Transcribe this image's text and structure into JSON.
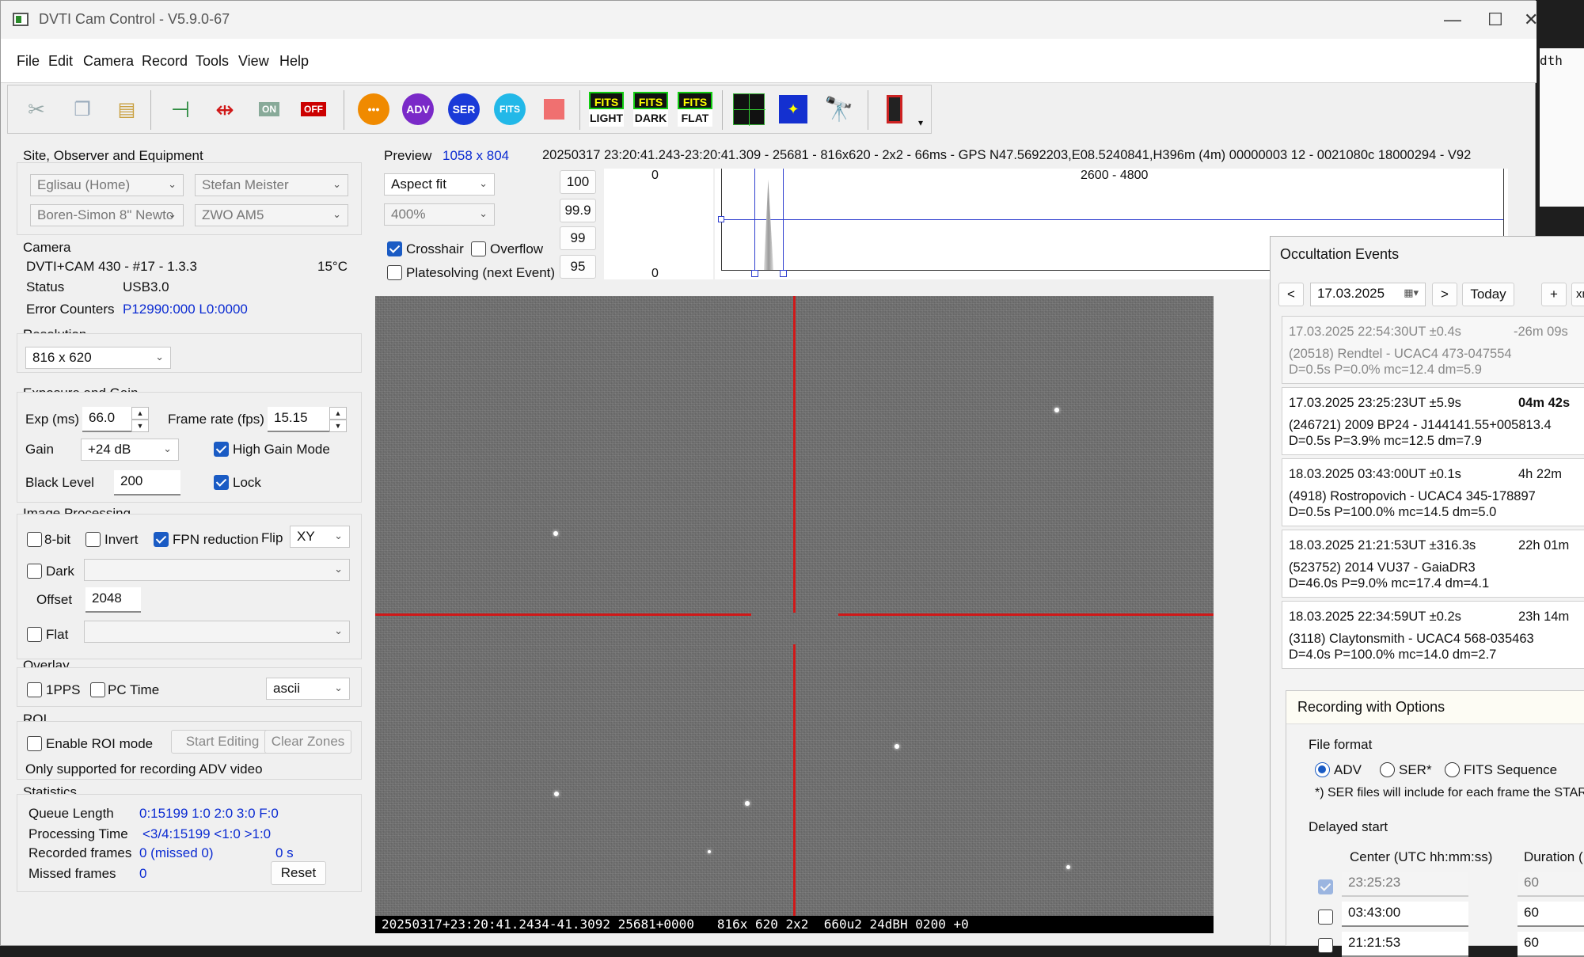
{
  "window": {
    "title": "DVTI Cam Control - V5.9.0-67",
    "min": "—",
    "max": "☐",
    "close": "✕"
  },
  "menu": [
    "File",
    "Edit",
    "Camera",
    "Record",
    "Tools",
    "View",
    "Help"
  ],
  "toolbar": {
    "adv": "ADV",
    "ser": "SER",
    "fits": "FITS",
    "on": "ON",
    "off": "OFF",
    "fits_light": [
      "FITS",
      "LIGHT"
    ],
    "fits_dark": [
      "FITS",
      "DARK"
    ],
    "fits_flat": [
      "FITS",
      "FLAT"
    ],
    "dropdown": "▾"
  },
  "site": {
    "title": "Site, Observer and Equipment",
    "site": "Eglisau (Home)",
    "observer": "Stefan Meister",
    "telescope": "Boren-Simon 8\" Newto",
    "mount": "ZWO AM5"
  },
  "camera": {
    "title": "Camera",
    "model": "DVTI+CAM 430  -  #17  -  1.3.3",
    "temp": "15°C",
    "status_label": "Status",
    "status": "USB3.0",
    "err_label": "Error Counters",
    "errors": "P12990:000 L0:0000"
  },
  "resolution": {
    "title": "Resolution",
    "value": "816 x 620"
  },
  "exposure": {
    "title": "Exposure and Gain",
    "exp_label": "Exp (ms)",
    "exp": "66.0",
    "fr_label": "Frame rate (fps)",
    "fr": "15.15",
    "gain_label": "Gain",
    "gain": "+24 dB",
    "hgm": "High Gain Mode",
    "bl_label": "Black Level",
    "bl": "200",
    "lock": "Lock"
  },
  "processing": {
    "title": "Image Processing",
    "bit8": "8-bit",
    "invert": "Invert",
    "fpn": "FPN reduction",
    "flip_label": "Flip",
    "flip": "XY",
    "dark": "Dark",
    "offset_label": "Offset",
    "offset": "2048",
    "flat": "Flat"
  },
  "overlay": {
    "title": "Overlay",
    "pps": "1PPS",
    "pctime": "PC Time",
    "mode": "ascii"
  },
  "roi": {
    "title": "ROI",
    "enable": "Enable ROI mode",
    "start": "Start Editing",
    "clear": "Clear Zones",
    "note": "Only supported for recording ADV video"
  },
  "stats": {
    "title": "Statistics",
    "ql_label": "Queue Length",
    "ql": "0:15199  1:0  2:0  3:0  F:0",
    "pt_label": "Processing Time",
    "pt": "<3/4:15199 <1:0  >1:0",
    "rf_label": "Recorded frames",
    "rf": "0 (missed 0)",
    "rf_time": "0 s",
    "mf_label": "Missed frames",
    "mf": "0",
    "reset": "Reset"
  },
  "preview": {
    "label": "Preview",
    "size": "1058 x 804",
    "info": "20250317 23:20:41.243-23:20:41.309 - 25681 - 816x620 - 2x2 - 66ms - GPS N47.5692203,E08.5240841,H396m (4m) 00000003 12 - 0021080c 18000294 - V92",
    "fit": "Aspect fit",
    "zoom": "400%",
    "crosshair": "Crosshair",
    "overflow": "Overflow",
    "platesolve": "Platesolving (next Event)",
    "levels": [
      "100",
      "99.9",
      "99",
      "95"
    ],
    "hist_top": "0",
    "hist_bottom": "0",
    "hist_range": "2600 - 4800"
  },
  "osd": "20250317+23:20:41.2434-41.3092 25681+0000   816x 620 2x2  660u2 24dBH 0200 +0",
  "occultation": {
    "title": "Occultation Events",
    "prev": "<",
    "date": "17.03.2025",
    "next": ">",
    "today": "Today",
    "plus": "+",
    "xm": "xm",
    "events": [
      {
        "time": "17.03.2025 22:54:30UT ±0.4s",
        "rel": "-26m 09s",
        "obj": "(20518) Rendtel - UCAC4 473-047554",
        "params": "D=0.5s   P=0.0%   mc=12.4   dm=5.9"
      },
      {
        "time": "17.03.2025 23:25:23UT  ±5.9s",
        "rel": "04m 42s",
        "obj": "(246721) 2009 BP24 - J144141.55+005813.4",
        "params": "D=0.5s   P=3.9%   mc=12.5   dm=7.9"
      },
      {
        "time": "18.03.2025 03:43:00UT ±0.1s",
        "rel": "4h 22m",
        "obj": "(4918) Rostropovich - UCAC4 345-178897",
        "params": "D=0.5s   P=100.0%   mc=14.5   dm=5.0"
      },
      {
        "time": "18.03.2025 21:21:53UT  ±316.3s",
        "rel": "22h 01m",
        "obj": "(523752) 2014 VU37 - GaiaDR3",
        "params": "D=46.0s   P=9.0%   mc=17.4   dm=4.1"
      },
      {
        "time": "18.03.2025 22:34:59UT ±0.2s",
        "rel": "23h 14m",
        "obj": "(3118) Claytonsmith - UCAC4 568-035463",
        "params": "D=4.0s   P=100.0%   mc=14.0   dm=2.7"
      }
    ]
  },
  "recording": {
    "title": "Recording with Options",
    "ff_label": "File format",
    "adv": "ADV",
    "ser": "SER*",
    "fits": "FITS Sequence",
    "note": "*) SER files will include for each frame the STAR",
    "delayed": "Delayed start",
    "center_hdr": "Center (UTC hh:mm:ss)",
    "dur_hdr": "Duration (",
    "rows": [
      {
        "center": "23:25:23",
        "dur": "60"
      },
      {
        "center": "03:43:00",
        "dur": "60"
      },
      {
        "center": "21:21:53",
        "dur": "60"
      }
    ]
  },
  "bg_right": "dth",
  "colors": {
    "accent": "#1a5bc4",
    "value_blue": "#0b2bd2",
    "crosshair": "#d01818"
  }
}
